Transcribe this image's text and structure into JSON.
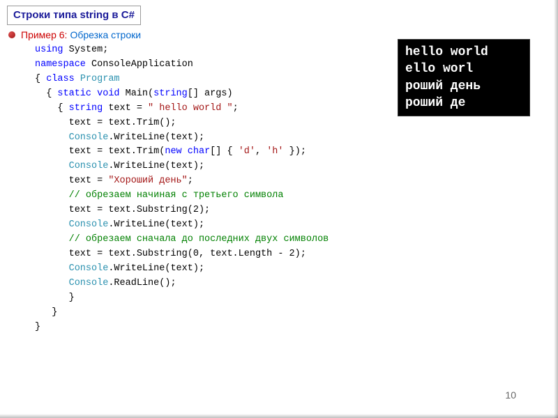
{
  "title": "Строки типа string в C#",
  "subtitle_label": "Пример 6:",
  "subtitle_desc": "Обрезка строки",
  "code": {
    "l01a": "using",
    "l01b": " System;",
    "l02a": "namespace",
    "l02b": " ConsoleApplication",
    "l03a": "{ ",
    "l03b": "class",
    "l03c": " ",
    "l03d": "Program",
    "l04a": "  { ",
    "l04b": "static",
    "l04c": " ",
    "l04d": "void",
    "l04e": " Main(",
    "l04f": "string",
    "l04g": "[] args)",
    "l05a": "    { ",
    "l05b": "string",
    "l05c": " text = ",
    "l05d": "\" hello world \"",
    "l05e": ";",
    "l06": "      text = text.Trim();",
    "l07a": "      ",
    "l07b": "Console",
    "l07c": ".WriteLine(text);",
    "l08a": "      text = text.Trim(",
    "l08b": "new",
    "l08c": " ",
    "l08d": "char",
    "l08e": "[] { ",
    "l08f": "'d'",
    "l08g": ", ",
    "l08h": "'h'",
    "l08i": " });",
    "l09a": "      ",
    "l09b": "Console",
    "l09c": ".WriteLine(text);",
    "l10a": "      text = ",
    "l10b": "\"Хороший день\"",
    "l10c": ";",
    "l11a": "      ",
    "l11b": "// обрезаем начиная с третьего символа",
    "l12": "      text = text.Substring(2);",
    "l13a": "      ",
    "l13b": "Console",
    "l13c": ".WriteLine(text);",
    "l14a": "      ",
    "l14b": "// обрезаем сначала до последних двух символов",
    "l15": "      text = text.Substring(0, text.Length - 2);",
    "l16a": "      ",
    "l16b": "Console",
    "l16c": ".WriteLine(text);",
    "l17a": "      ",
    "l17b": "Console",
    "l17c": ".ReadLine();",
    "l18": "      }",
    "l19": "   }",
    "l20": "}"
  },
  "console_output": {
    "line1": "hello world",
    "line2": "ello worl",
    "line3": "роший день",
    "line4": "роший де"
  },
  "page_number": "10"
}
